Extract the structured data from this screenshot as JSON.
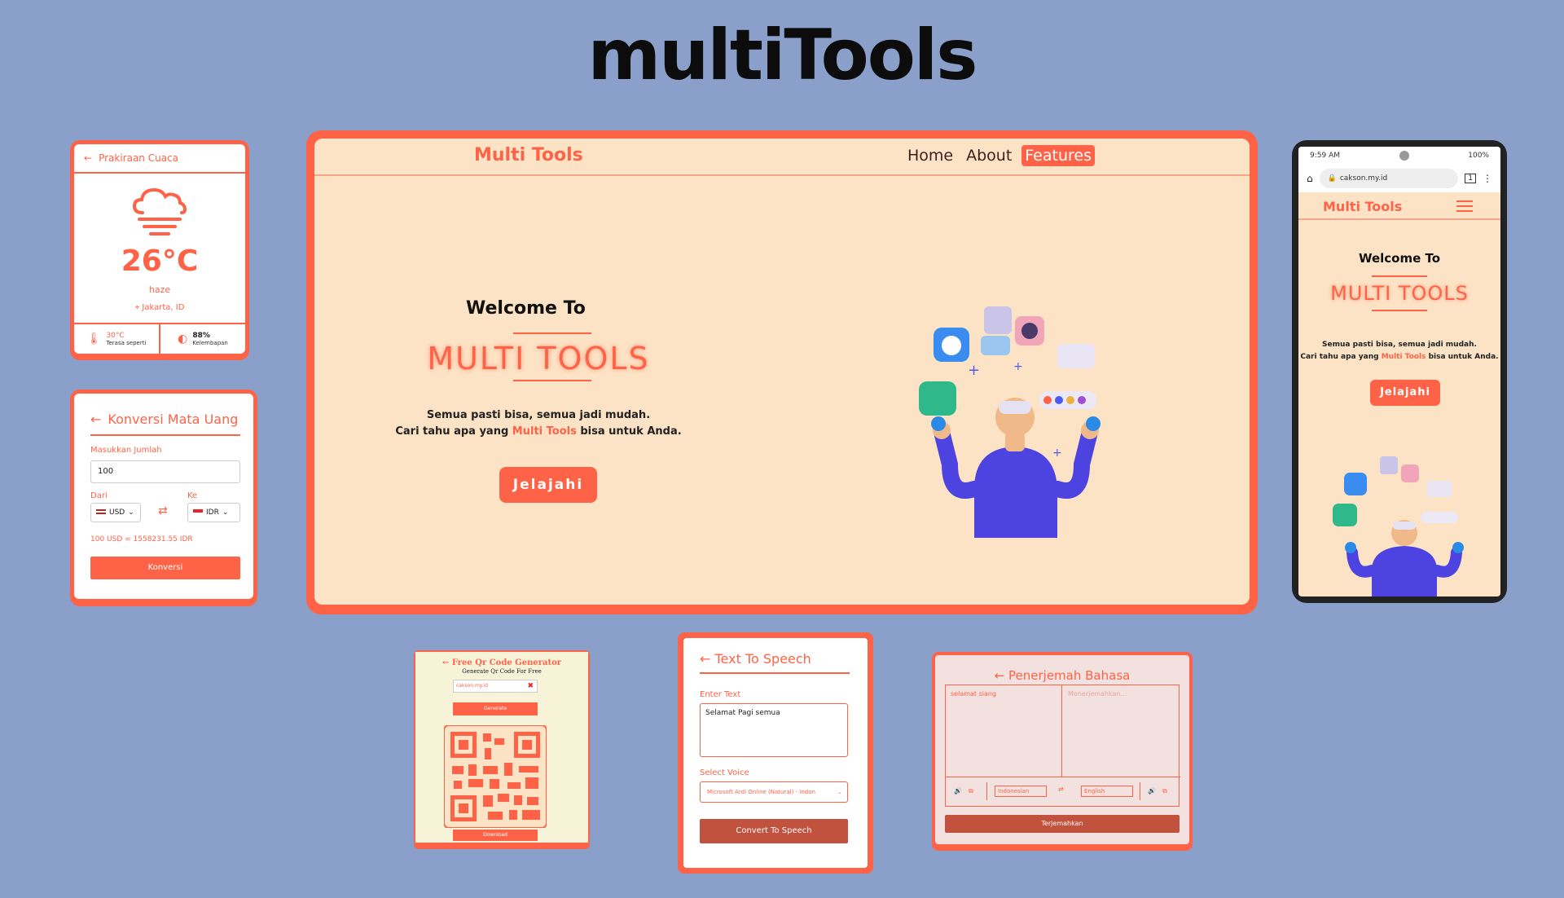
{
  "title": "multiTools",
  "weather": {
    "header": "Prakiraan Cuaca",
    "temperature": "26°C",
    "description": "haze",
    "location": "Jakarta, ID",
    "feels_value": "30°C",
    "feels_label": "Terasa seperti",
    "humidity_value": "88%",
    "humidity_label": "Kelembapan"
  },
  "currency": {
    "header": "Konversi Mata Uang",
    "amount_label": "Masukkan Jumlah",
    "amount_value": "100",
    "from_label": "Dari",
    "to_label": "Ke",
    "from_value": "USD",
    "to_value": "IDR",
    "result": "100 USD = 1558231.55 IDR",
    "button": "Konversi"
  },
  "desktop": {
    "logo": "Multi Tools",
    "nav": [
      "Home",
      "About",
      "Features"
    ],
    "active_nav": "Features",
    "welcome": "Welcome To",
    "brand": "MULTI TOOLS",
    "line1": "Semua pasti bisa, semua jadi mudah.",
    "line2_pre": "Cari tahu apa yang",
    "line2_hl": "Multi Tools",
    "line2_post": "bisa untuk Anda.",
    "button": "Jelajahi"
  },
  "phone": {
    "time": "9:59 AM",
    "battery": "100%",
    "tab_count": "1",
    "url": "cakson.my.id",
    "logo": "Multi Tools",
    "welcome": "Welcome To",
    "brand": "MULTI TOOLS",
    "line1": "Semua pasti bisa, semua jadi mudah.",
    "line2_pre": "Cari tahu apa yang",
    "line2_hl": "Multi Tools",
    "line2_post": "bisa untuk Anda.",
    "button": "Jelajahi"
  },
  "qr": {
    "title": "Free Qr Code Generator",
    "subtitle": "Generate Qr Code For Free",
    "input_value": "cakson.my.id",
    "generate": "Generate",
    "download": "Download"
  },
  "tts": {
    "title": "Text To Speech",
    "enter_label": "Enter Text",
    "text_value": "Selamat Pagi semua",
    "voice_label": "Select Voice",
    "voice_value": "Microsoft Ardi Online (Natural) - Indon",
    "button": "Convert To Speech"
  },
  "translator": {
    "title": "Penerjemah Bahasa",
    "source_text": "selamat siang",
    "target_placeholder": "Menerjemahkan...",
    "source_lang": "Indonesian",
    "target_lang": "English",
    "button": "Terjemahkan"
  },
  "colors": {
    "background": "#8aa0cb",
    "accent": "#ff6347",
    "cream": "#fde3c5"
  }
}
